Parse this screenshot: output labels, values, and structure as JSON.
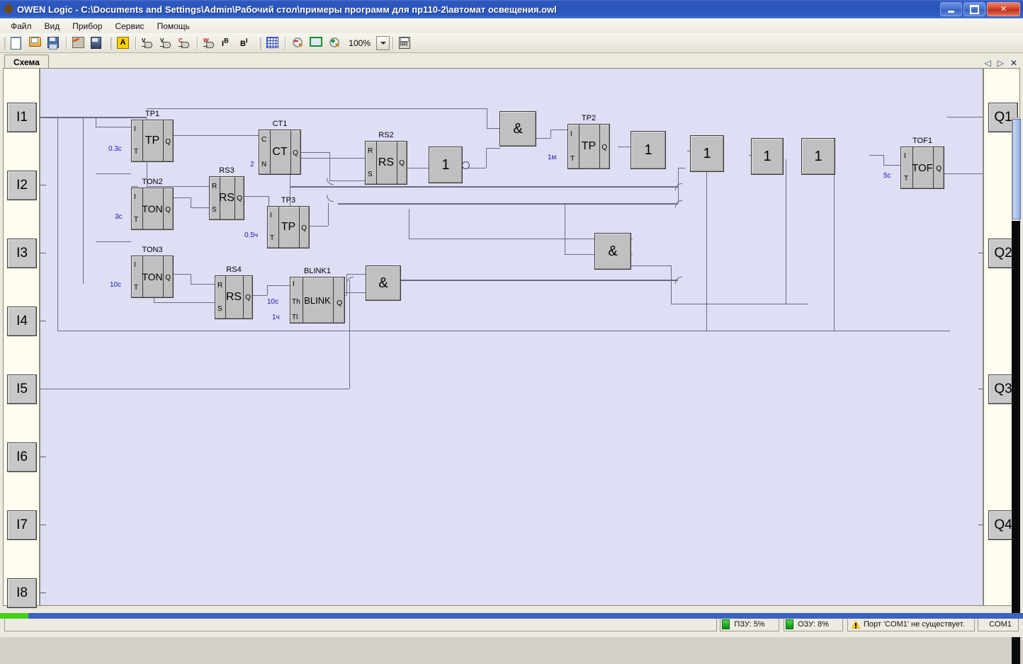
{
  "window": {
    "title": "OWEN Logic - C:\\Documents and Settings\\Admin\\Рабочий стол\\примеры программ для  пр110-2\\автомат освещения.owl",
    "icon": "bug-icon",
    "minimize": "minimize-button",
    "restore": "restore-button",
    "close": "close-button"
  },
  "menu": {
    "items": [
      {
        "label": "Файл"
      },
      {
        "label": "Вид"
      },
      {
        "label": "Прибор"
      },
      {
        "label": "Сервис"
      },
      {
        "label": "Помощь"
      }
    ]
  },
  "toolbar": {
    "buttons": [
      {
        "name": "new-file-icon"
      },
      {
        "name": "open-file-icon"
      },
      {
        "name": "save-file-icon"
      },
      {
        "name": "edit-project-icon"
      },
      {
        "name": "device-icon"
      },
      {
        "name": "text-label-icon",
        "glyph": "A"
      },
      {
        "name": "input-variable-icon",
        "glyph": "V"
      },
      {
        "name": "output-variable-icon",
        "glyph": "V"
      },
      {
        "name": "constant-icon",
        "glyph": "C"
      },
      {
        "name": "word-variable-icon",
        "glyph": "W"
      },
      {
        "name": "int-to-bool-icon",
        "glyph": "I"
      },
      {
        "name": "bool-to-int-icon",
        "glyph": "B"
      },
      {
        "name": "grid-icon"
      },
      {
        "name": "zoom-out-icon"
      },
      {
        "name": "zoom-fit-icon"
      },
      {
        "name": "zoom-in-icon"
      },
      {
        "name": "calculator-icon"
      }
    ],
    "zoom_value": "100%"
  },
  "tabs": {
    "items": [
      {
        "label": "Схема"
      }
    ],
    "nav": {
      "prev": "◁",
      "next": "▷",
      "close": "✕"
    }
  },
  "diagram": {
    "inputs": [
      {
        "label": "I1"
      },
      {
        "label": "I2"
      },
      {
        "label": "I3"
      },
      {
        "label": "I4"
      },
      {
        "label": "I5"
      },
      {
        "label": "I6"
      },
      {
        "label": "I7"
      },
      {
        "label": "I8"
      }
    ],
    "outputs": [
      {
        "label": "Q1"
      },
      {
        "label": "Q2"
      },
      {
        "label": "Q3"
      },
      {
        "label": "Q4"
      }
    ],
    "blocks": [
      {
        "id": "TP1",
        "name": "TP1",
        "type": "TP",
        "pins_left": [
          "I",
          "T"
        ],
        "pin_right": "Q",
        "param": "0.3c"
      },
      {
        "id": "TON2",
        "name": "TON2",
        "type": "TON",
        "pins_left": [
          "I",
          "T"
        ],
        "pin_right": "Q",
        "param": "3c"
      },
      {
        "id": "TON3",
        "name": "TON3",
        "type": "TON",
        "pins_left": [
          "I",
          "T"
        ],
        "pin_right": "Q",
        "param": "10c"
      },
      {
        "id": "CT1",
        "name": "CT1",
        "type": "CT",
        "pins_left": [
          "C",
          "N"
        ],
        "pin_right": "Q",
        "param": "2"
      },
      {
        "id": "RS3",
        "name": "RS3",
        "type": "RS",
        "pins_left": [
          "R",
          "S"
        ],
        "pin_right": "Q",
        "param": ""
      },
      {
        "id": "RS4",
        "name": "RS4",
        "type": "RS",
        "pins_left": [
          "R",
          "S"
        ],
        "pin_right": "Q",
        "param": ""
      },
      {
        "id": "RS2",
        "name": "RS2",
        "type": "RS",
        "pins_left": [
          "R",
          "S"
        ],
        "pin_right": "Q",
        "param": ""
      },
      {
        "id": "TP3",
        "name": "TP3",
        "type": "TP",
        "pins_left": [
          "I",
          "T"
        ],
        "pin_right": "Q",
        "param": "0.5ч"
      },
      {
        "id": "TP2",
        "name": "TP2",
        "type": "TP",
        "pins_left": [
          "I",
          "T"
        ],
        "pin_right": "Q",
        "param": "1м"
      },
      {
        "id": "TOF1",
        "name": "TOF1",
        "type": "TOF",
        "pins_left": [
          "I",
          "T"
        ],
        "pin_right": "Q",
        "param": "5c"
      },
      {
        "id": "BLINK1",
        "name": "BLINK1",
        "type": "BLINK",
        "pins_left": [
          "Th",
          "Tl"
        ],
        "pin_right": "Q",
        "param": "10c",
        "param2": "1ч"
      }
    ],
    "gates": [
      {
        "id": "g-not1",
        "symbol": "1",
        "inverted": true
      },
      {
        "id": "g-and1",
        "symbol": "&"
      },
      {
        "id": "g-or1",
        "symbol": "1"
      },
      {
        "id": "g-or2",
        "symbol": "1"
      },
      {
        "id": "g-or3",
        "symbol": "1"
      },
      {
        "id": "g-or4",
        "symbol": "1"
      },
      {
        "id": "g-and2",
        "symbol": "&"
      },
      {
        "id": "g-and3",
        "symbol": "&"
      }
    ]
  },
  "statusbar": {
    "rom": "ПЗУ: 5%",
    "ram": "ОЗУ: 8%",
    "port_warning": "Порт 'COM1' не существует.",
    "port": "COM1"
  },
  "colors": {
    "titlebar": "#2a55bc",
    "canvas": "#dedef5",
    "block_fill": "#c0c0c0",
    "wire": "#6b6b80",
    "param_text": "#1a1ab0",
    "rail": "#fffdf0"
  }
}
